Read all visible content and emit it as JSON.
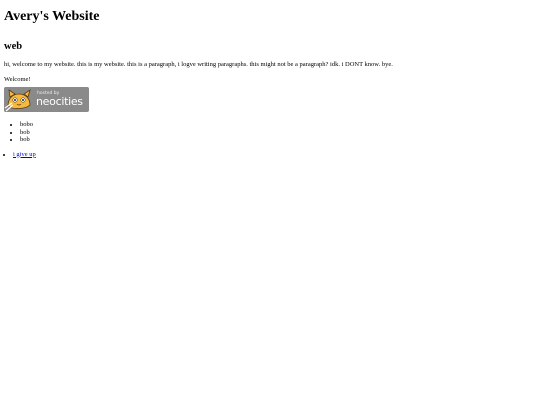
{
  "page": {
    "title": "Avery's Website",
    "subtitle": "web",
    "intro": "hi, welcome to my website. this is my website. this is a paragraph, i logve writing paragraphs. this might not be a paragraph? idk. i DONT know. bye.",
    "welcome": "Welcome!"
  },
  "badge": {
    "line1": "hosted by",
    "line2": "neocities",
    "background": "#8a8a8a",
    "icon": "neocities-cat-icon"
  },
  "list": {
    "items": [
      "bobo",
      "bob",
      "bob"
    ]
  },
  "links": {
    "items": [
      "i give up"
    ],
    "color": "#0000ee"
  }
}
